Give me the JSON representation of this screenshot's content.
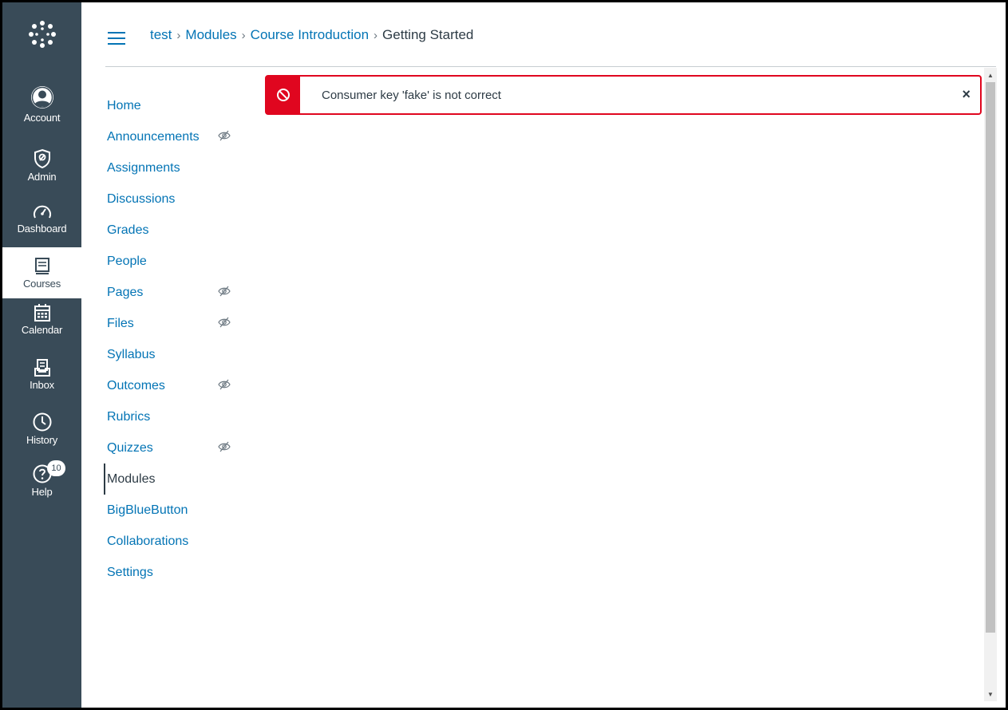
{
  "global_nav": {
    "items": [
      {
        "label": "Account",
        "icon": "account-icon"
      },
      {
        "label": "Admin",
        "icon": "admin-shield-icon"
      },
      {
        "label": "Dashboard",
        "icon": "dashboard-gauge-icon"
      },
      {
        "label": "Courses",
        "icon": "courses-book-icon",
        "active": true
      },
      {
        "label": "Calendar",
        "icon": "calendar-icon"
      },
      {
        "label": "Inbox",
        "icon": "inbox-icon"
      },
      {
        "label": "History",
        "icon": "clock-icon"
      },
      {
        "label": "Help",
        "icon": "help-icon",
        "badge": "10"
      }
    ],
    "colors": {
      "background": "#394b58",
      "active_background": "#ffffff"
    }
  },
  "breadcrumb": {
    "items": [
      "test",
      "Modules",
      "Course Introduction"
    ],
    "current": "Getting Started",
    "separator": "›"
  },
  "course_nav": {
    "items": [
      {
        "label": "Home",
        "hidden": false
      },
      {
        "label": "Announcements",
        "hidden": true
      },
      {
        "label": "Assignments",
        "hidden": false
      },
      {
        "label": "Discussions",
        "hidden": false
      },
      {
        "label": "Grades",
        "hidden": false
      },
      {
        "label": "People",
        "hidden": false
      },
      {
        "label": "Pages",
        "hidden": true
      },
      {
        "label": "Files",
        "hidden": true
      },
      {
        "label": "Syllabus",
        "hidden": false
      },
      {
        "label": "Outcomes",
        "hidden": true
      },
      {
        "label": "Rubrics",
        "hidden": false
      },
      {
        "label": "Quizzes",
        "hidden": true
      },
      {
        "label": "Modules",
        "hidden": false,
        "active": true
      },
      {
        "label": "BigBlueButton",
        "hidden": false
      },
      {
        "label": "Collaborations",
        "hidden": false
      },
      {
        "label": "Settings",
        "hidden": false
      }
    ],
    "colors": {
      "link": "#0374b5",
      "active": "#2d3b45"
    }
  },
  "alert": {
    "message": "Consumer key 'fake' is not correct",
    "close_label": "×",
    "icon": "no-entry-icon",
    "color": "#e0061f"
  }
}
